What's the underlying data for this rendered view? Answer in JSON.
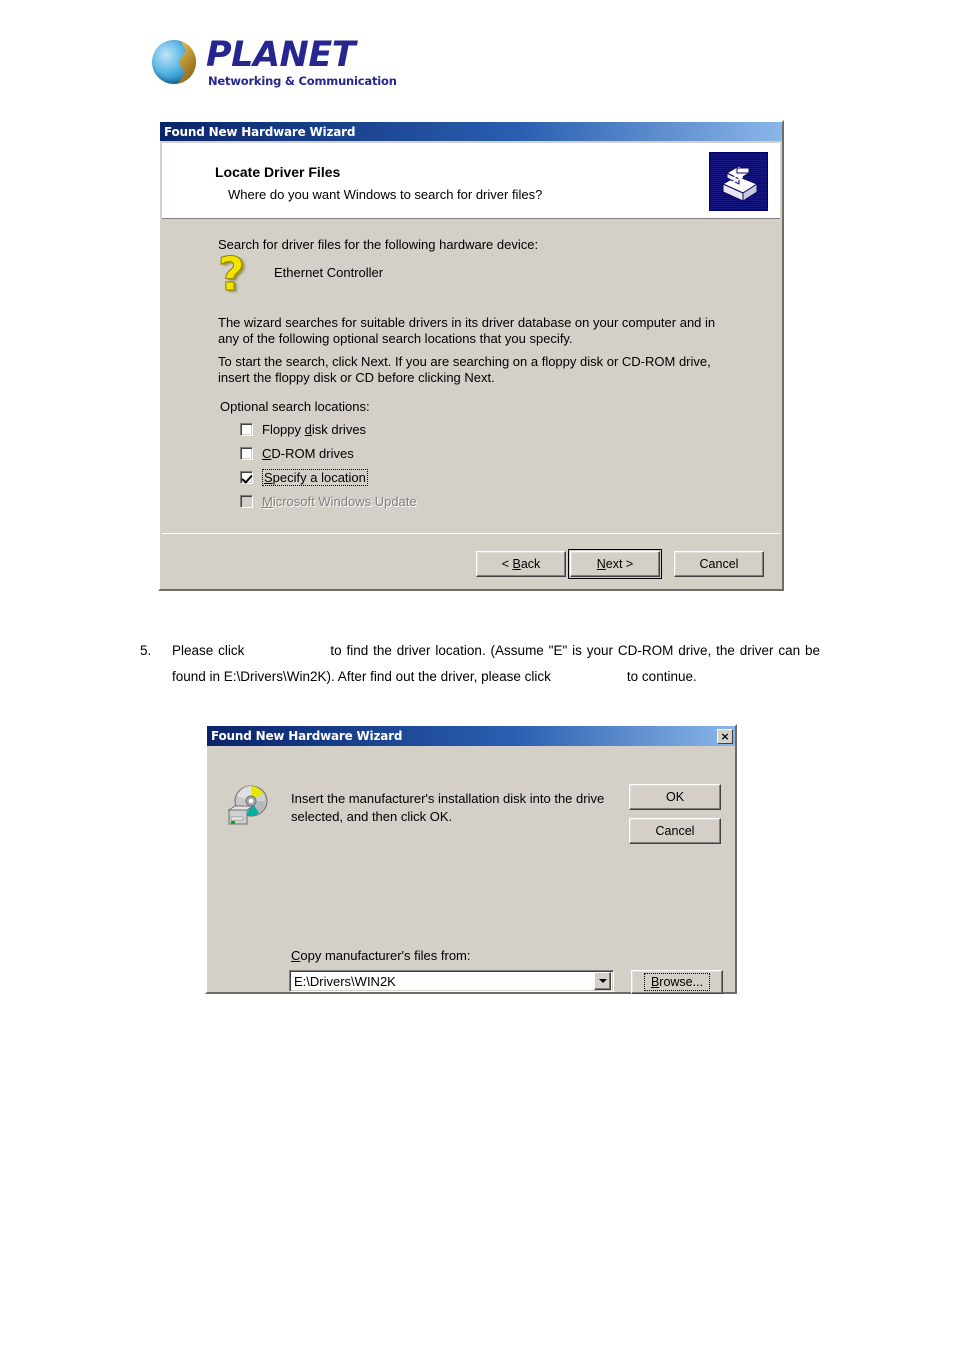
{
  "brand": {
    "name": "PLANET",
    "tagline": "Networking & Communication",
    "logo_icon": "planet-globe-icon",
    "color": "#27268f"
  },
  "wizard_dialog": {
    "title": "Found New Hardware Wizard",
    "banner_icon": "driver-files-box-icon",
    "header": {
      "title": "Locate Driver Files",
      "subtitle": "Where do you want Windows to search for driver files?"
    },
    "body": {
      "intro": "Search for driver files for the following hardware device:",
      "device_icon": "unknown-device-question-icon",
      "device_name": "Ethernet Controller",
      "paragraph1": "The wizard searches for suitable drivers in its driver database on your computer and in any of the following optional search locations that you specify.",
      "paragraph2": "To start the search, click Next. If you are searching on a floppy disk or CD-ROM drive, insert the floppy disk or CD before clicking Next.",
      "options_label": "Optional search locations:",
      "options": [
        {
          "label": "Floppy disk drives",
          "acc_before": "Floppy ",
          "acc_key": "d",
          "acc_after": "isk drives",
          "checked": false,
          "disabled": false,
          "focused": false
        },
        {
          "label": "CD-ROM drives",
          "acc_before": "",
          "acc_key": "C",
          "acc_after": "D-ROM drives",
          "checked": false,
          "disabled": false,
          "focused": false
        },
        {
          "label": "Specify a location",
          "acc_before": "",
          "acc_key": "S",
          "acc_after": "pecify a location",
          "checked": true,
          "disabled": false,
          "focused": true
        },
        {
          "label": "Microsoft Windows Update",
          "acc_before": "",
          "acc_key": "M",
          "acc_after": "icrosoft Windows Update",
          "checked": false,
          "disabled": true,
          "focused": false
        }
      ]
    },
    "buttons": {
      "back": {
        "before": "< ",
        "acc_key": "B",
        "after": "ack"
      },
      "next": {
        "before": "",
        "acc_key": "N",
        "after": "ext >",
        "default": true
      },
      "cancel": "Cancel"
    }
  },
  "step": {
    "number": "5.",
    "part1": "Please click",
    "part2": "to find the driver location. (Assume \"E\" is your CD-ROM drive, the driver can be found in E:\\Drivers\\Win2K). After find out the driver, please click",
    "part3": "to continue."
  },
  "insert_disk_dialog": {
    "title": "Found New Hardware Wizard",
    "close_glyph": "×",
    "close_icon": "close-icon",
    "disk_icon": "cdrom-drive-icon",
    "message": "Insert the manufacturer's installation disk into the drive selected, and then click OK.",
    "ok_label": "OK",
    "cancel_label": "Cancel",
    "copy_from_label": {
      "acc_key": "C",
      "after": "opy manufacturer's files from:"
    },
    "path_value": "E:\\Drivers\\WIN2K",
    "dropdown_icon": "chevron-down-icon",
    "browse_label": {
      "before": "",
      "acc_key": "B",
      "after": "rowse..."
    }
  }
}
